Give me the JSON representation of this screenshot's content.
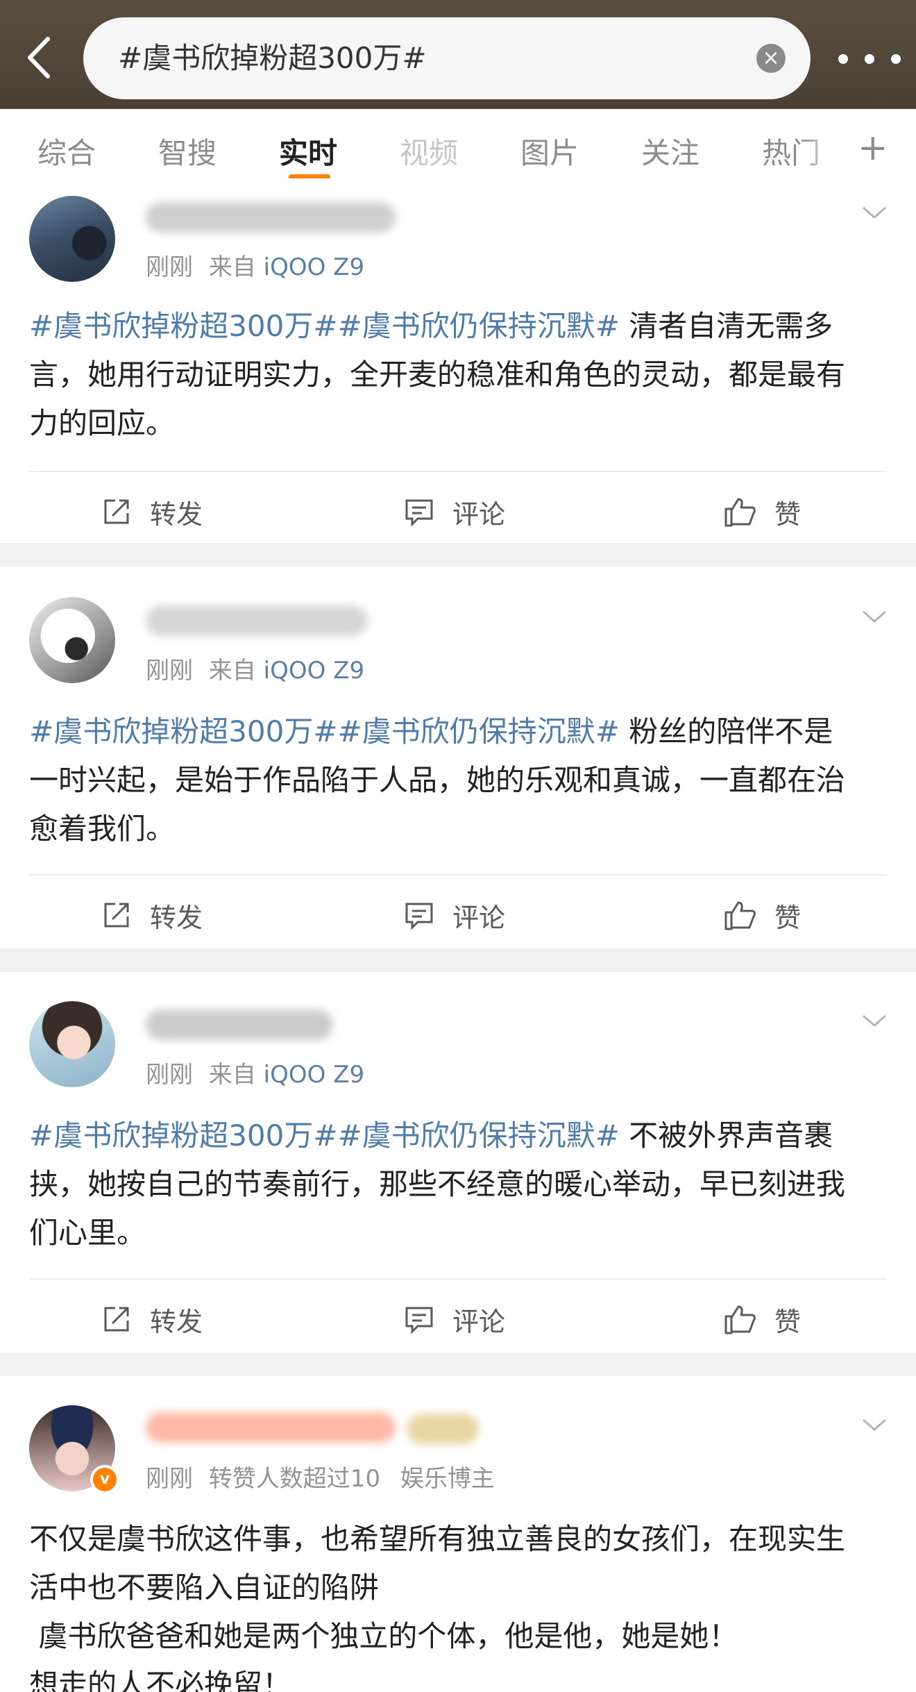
{
  "search": {
    "query": "#虞书欣掉粉超300万#",
    "clear_glyph": "×"
  },
  "tabs": [
    {
      "label": "综合"
    },
    {
      "label": "智搜"
    },
    {
      "label": "实时",
      "active": true
    },
    {
      "label": "视频"
    },
    {
      "label": "图片"
    },
    {
      "label": "关注"
    },
    {
      "label": "热门"
    }
  ],
  "tab_plus": "+",
  "colors": {
    "accent": "#ff8200",
    "link": "#4f7cab",
    "header": "#4d4236"
  },
  "actions": {
    "repost": "转发",
    "comment": "评论",
    "like": "赞"
  },
  "posts": [
    {
      "time": "刚刚",
      "source_prefix": "来自",
      "device": "iQOO Z9",
      "tags": "#虞书欣掉粉超300万##虞书欣仍保持沉默#",
      "text": " 清者自清无需多言，她用行动证明实力，全开麦的稳准和角色的灵动，都是最有力的回应。"
    },
    {
      "time": "刚刚",
      "source_prefix": "来自",
      "device": "iQOO Z9",
      "tags": "#虞书欣掉粉超300万##虞书欣仍保持沉默#",
      "text": " 粉丝的陪伴不是一时兴起，是始于作品陷于人品，她的乐观和真诚，一直都在治愈着我们。"
    },
    {
      "time": "刚刚",
      "source_prefix": "来自",
      "device": "iQOO Z9",
      "tags": "#虞书欣掉粉超300万##虞书欣仍保持沉默#",
      "text": " 不被外界声音裹挟，她按自己的节奏前行，那些不经意的暖心举动，早已刻进我们心里。"
    },
    {
      "time": "刚刚",
      "meta_extra": "转赞人数超过10",
      "role": "娱乐博主",
      "badge": "v",
      "lines": [
        "不仅是虞书欣这件事，也希望所有独立善良的女孩们，在现实生活中也不要陷入自证的陷阱",
        " 虞书欣爸爸和她是两个独立的个体，他是他，她是她！",
        "想走的人不必挽留！"
      ]
    }
  ]
}
